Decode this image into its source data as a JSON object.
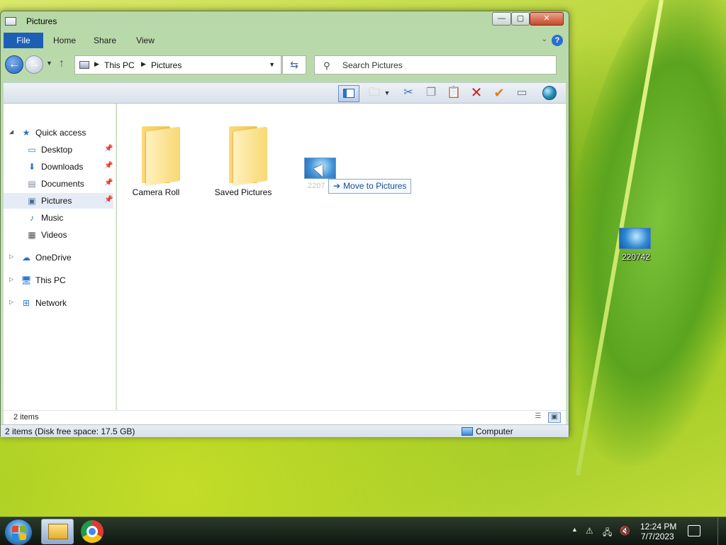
{
  "window": {
    "title": "Pictures",
    "controls": {
      "minimize": "—",
      "maximize": "▢",
      "close": "✕"
    }
  },
  "ribbon": {
    "tabs": [
      "File",
      "Home",
      "Share",
      "View"
    ],
    "help": "?"
  },
  "address": {
    "crumbs": [
      "This PC",
      "Pictures"
    ]
  },
  "search": {
    "placeholder": "Search Pictures"
  },
  "nav_pane": {
    "items": [
      {
        "label": "Quick access",
        "icon": "star-icon",
        "expand": "◢",
        "pinned": false
      },
      {
        "label": "Desktop",
        "icon": "desktop-icon",
        "pinned": true
      },
      {
        "label": "Downloads",
        "icon": "download-icon",
        "pinned": true
      },
      {
        "label": "Documents",
        "icon": "documents-icon",
        "pinned": true
      },
      {
        "label": "Pictures",
        "icon": "pictures-icon",
        "pinned": true,
        "selected": true
      },
      {
        "label": "Music",
        "icon": "music-icon",
        "pinned": false
      },
      {
        "label": "Videos",
        "icon": "videos-icon",
        "pinned": false
      },
      {
        "label": "OneDrive",
        "icon": "cloud-icon",
        "expand": "▷"
      },
      {
        "label": "This PC",
        "icon": "computer-icon",
        "expand": "▷"
      },
      {
        "label": "Network",
        "icon": "network-icon",
        "expand": "▷"
      }
    ]
  },
  "content": {
    "folders": [
      {
        "label": "Camera Roll"
      },
      {
        "label": "Saved Pictures"
      }
    ],
    "drag": {
      "file_label_partial": "2207",
      "tooltip_arrow": "➔",
      "tooltip": "Move to Pictures"
    }
  },
  "status": {
    "items": "2 items",
    "details": "2 items (Disk free space: 17.5 GB)",
    "location": "Computer"
  },
  "desktop": {
    "icon_label": "220742"
  },
  "taskbar": {
    "time": "12:24 PM",
    "date": "7/7/2023",
    "tray_expand": "▲"
  },
  "colors": {
    "file_tab": "#1e5fb6",
    "delete": "#d11c1c",
    "accept": "#e07d16"
  }
}
